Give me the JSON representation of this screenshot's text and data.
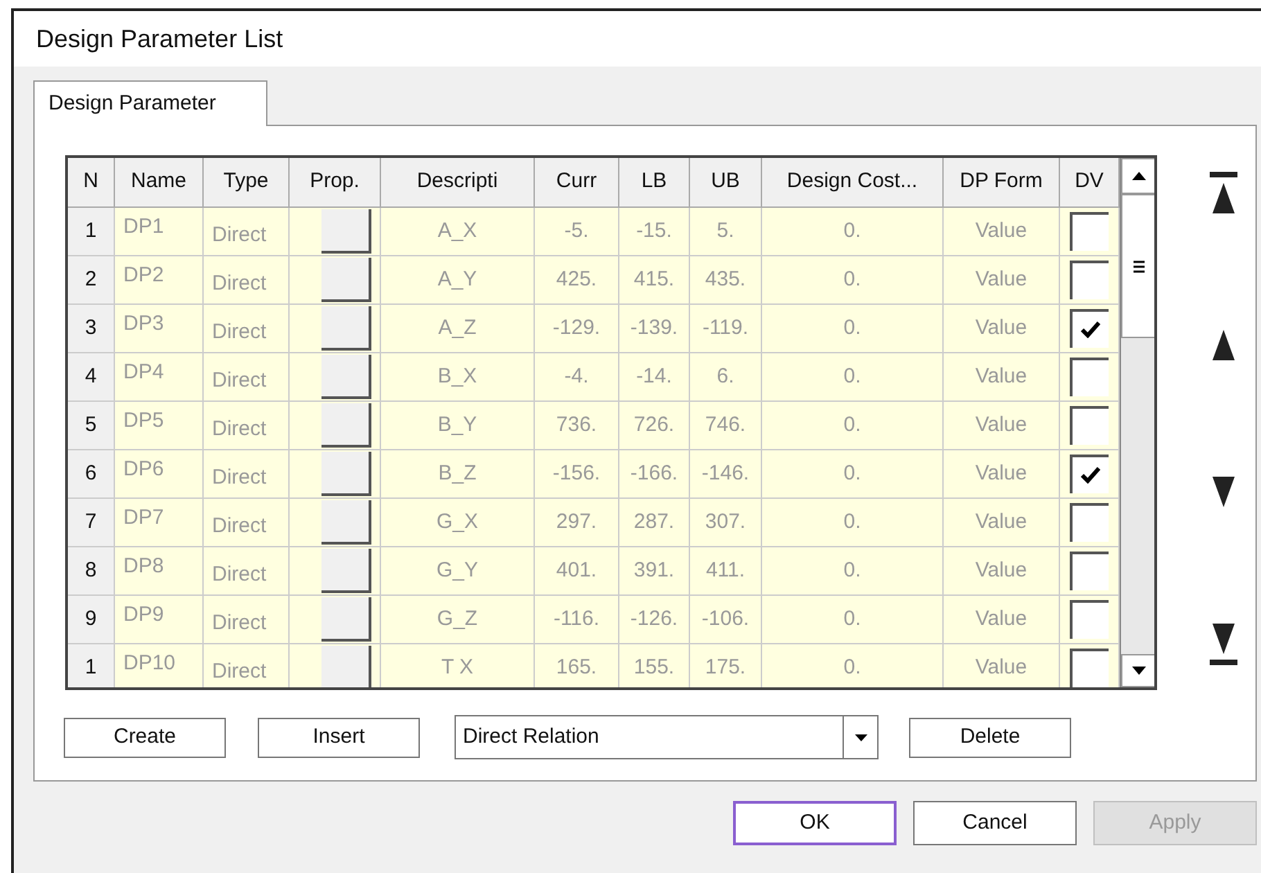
{
  "window": {
    "title": "Design Parameter List"
  },
  "tabs": [
    {
      "label": "Design Parameter",
      "selected": true
    }
  ],
  "table": {
    "columns": [
      "N",
      "Name",
      "Type",
      "Prop.",
      "Descripti",
      "Curr",
      "LB",
      "UB",
      "Design Cost...",
      "DP Form",
      "DV"
    ],
    "rows": [
      {
        "n": "1",
        "name": "DP1",
        "type": "Direct",
        "description": "A_X",
        "curr": "-5.",
        "lb": "-15.",
        "ub": "5.",
        "design_cost": "0.",
        "dp_form": "Value",
        "dv": false
      },
      {
        "n": "2",
        "name": "DP2",
        "type": "Direct",
        "description": "A_Y",
        "curr": "425.",
        "lb": "415.",
        "ub": "435.",
        "design_cost": "0.",
        "dp_form": "Value",
        "dv": false
      },
      {
        "n": "3",
        "name": "DP3",
        "type": "Direct",
        "description": "A_Z",
        "curr": "-129.",
        "lb": "-139.",
        "ub": "-119.",
        "design_cost": "0.",
        "dp_form": "Value",
        "dv": true
      },
      {
        "n": "4",
        "name": "DP4",
        "type": "Direct",
        "description": "B_X",
        "curr": "-4.",
        "lb": "-14.",
        "ub": "6.",
        "design_cost": "0.",
        "dp_form": "Value",
        "dv": false
      },
      {
        "n": "5",
        "name": "DP5",
        "type": "Direct",
        "description": "B_Y",
        "curr": "736.",
        "lb": "726.",
        "ub": "746.",
        "design_cost": "0.",
        "dp_form": "Value",
        "dv": false
      },
      {
        "n": "6",
        "name": "DP6",
        "type": "Direct",
        "description": "B_Z",
        "curr": "-156.",
        "lb": "-166.",
        "ub": "-146.",
        "design_cost": "0.",
        "dp_form": "Value",
        "dv": true
      },
      {
        "n": "7",
        "name": "DP7",
        "type": "Direct",
        "description": "G_X",
        "curr": "297.",
        "lb": "287.",
        "ub": "307.",
        "design_cost": "0.",
        "dp_form": "Value",
        "dv": false
      },
      {
        "n": "8",
        "name": "DP8",
        "type": "Direct",
        "description": "G_Y",
        "curr": "401.",
        "lb": "391.",
        "ub": "411.",
        "design_cost": "0.",
        "dp_form": "Value",
        "dv": false
      },
      {
        "n": "9",
        "name": "DP9",
        "type": "Direct",
        "description": "G_Z",
        "curr": "-116.",
        "lb": "-126.",
        "ub": "-106.",
        "design_cost": "0.",
        "dp_form": "Value",
        "dv": false
      },
      {
        "n": "1",
        "name": "DP10",
        "type": "Direct",
        "description": "T X",
        "curr": "165.",
        "lb": "155.",
        "ub": "175.",
        "design_cost": "0.",
        "dp_form": "Value",
        "dv": false
      }
    ]
  },
  "actions": [
    "Create",
    "Insert"
  ],
  "relation_dropdown": {
    "value": "Direct Relation"
  },
  "delete_button": "Delete",
  "buttons": [
    {
      "label": "OK",
      "focused": true,
      "disabled": false
    },
    {
      "label": "Cancel",
      "focused": false,
      "disabled": false
    },
    {
      "label": "Apply",
      "focused": false,
      "disabled": true
    }
  ]
}
